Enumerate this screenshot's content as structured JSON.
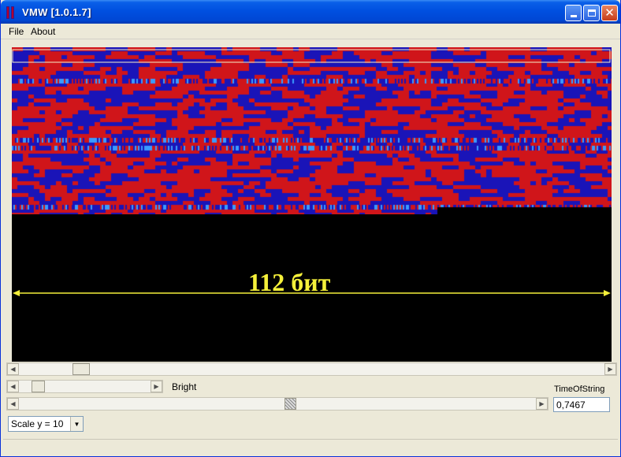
{
  "window": {
    "title": "VMW [1.0.1.7]"
  },
  "menu": {
    "items": [
      "File",
      "About"
    ]
  },
  "viewer": {
    "overlay_text": "112 бит"
  },
  "controls": {
    "bright_label": "Bright",
    "time_label": "TimeOfString",
    "time_value": "0,7467",
    "scale_value": "Scale y = 10"
  },
  "colors": {
    "red": "#d0151a",
    "blue": "#1a14b8",
    "overlay": "#f5f03a"
  },
  "icons": [
    "app-icon",
    "minimize-icon",
    "maximize-icon",
    "close-icon",
    "arrow-left-icon",
    "arrow-right-icon",
    "dropdown-arrow-icon"
  ]
}
